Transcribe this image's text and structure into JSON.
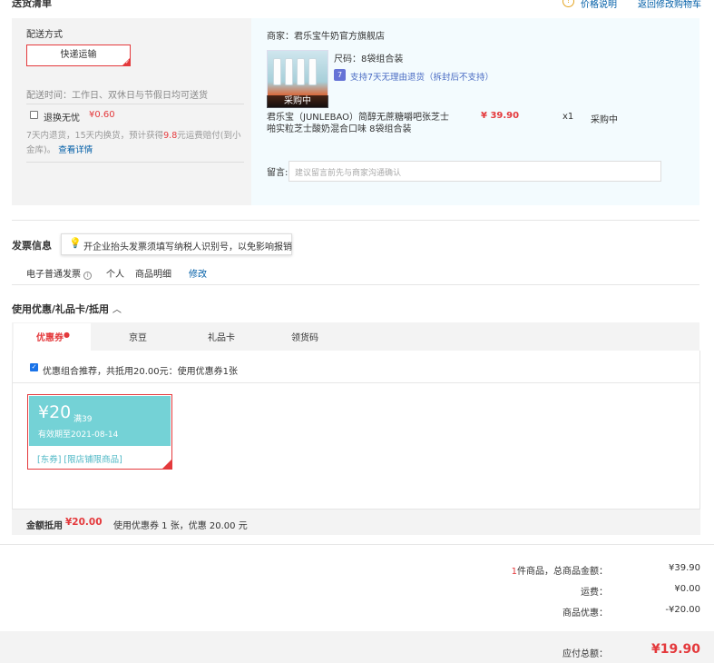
{
  "header": {
    "title": "送货清单",
    "price_note": "价格说明",
    "back_to_cart": "返回修改购物车"
  },
  "shipping": {
    "method_label": "配送方式",
    "method_value": "快递运输",
    "delivery_time": "配送时间：工作日、双休日与节假日均可送货",
    "worry_free_label": "退换无忧",
    "worry_free_price": "¥0.60",
    "worry_free_desc_1": "7天内退货，15天内换货，预计获得",
    "worry_free_desc_amount": "9.8",
    "worry_free_desc_2": "元运费赔付(到小",
    "worry_free_desc_3": "金库)。",
    "details_link": "查看详情"
  },
  "order": {
    "merchant": "商家：君乐宝牛奶官方旗舰店",
    "size": "尺码：8袋组合装",
    "return_policy": "支持7天无理由退货（拆封后不支持）",
    "return_icon": "7",
    "product_tag": "采购中",
    "product_name_1": "君乐宝（JUNLEBAO）简醇无蔗糖嚼吧张芝士",
    "product_name_2": "啪实粒芝士酸奶混合口味 8袋组合装",
    "price": "¥ 39.90",
    "qty": "x1",
    "status": "采购中",
    "note_label": "留言:",
    "note_placeholder": "建议留言前先与商家沟通确认"
  },
  "invoice": {
    "title": "发票信息",
    "tooltip": "开企业抬头发票须填写纳税人识别号，以免影响报销",
    "type": "电子普通发票",
    "owner": "个人",
    "content": "商品明细",
    "edit": "修改"
  },
  "coupons": {
    "section_title": "使用优惠/礼品卡/抵用",
    "tabs": [
      "优惠券",
      "京豆",
      "礼品卡",
      "领货码"
    ],
    "combo_text": "优惠组合推荐，共抵用20.00元：使用优惠券1张",
    "coupon_amount": "¥20",
    "coupon_threshold": "满39",
    "coupon_expiry": "有效期至2021-08-14",
    "coupon_tags": "[东券] [限店铺限商品]",
    "discount_label": "金额抵用",
    "discount_amount": "¥20.00",
    "discount_desc": "使用优惠券 1 张，优惠 20.00 元"
  },
  "totals": {
    "item_count": "1",
    "item_label": "件商品，总商品金额：",
    "goods_total": "¥39.90",
    "shipping_label": "运费：",
    "shipping_fee": "¥0.00",
    "discount_label": "商品优惠：",
    "discount": "-¥20.00",
    "payable_label": "应付总额：",
    "payable": "¥19.90"
  },
  "colors": {
    "accent_red": "#e4393c",
    "link_blue": "#005ea7",
    "coupon_teal": "#74d2d6"
  }
}
